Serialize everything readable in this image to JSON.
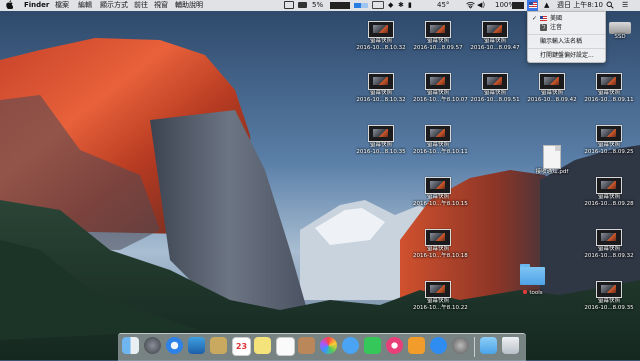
{
  "menubar": {
    "app_name": "Finder",
    "menus": [
      "檔案",
      "編輯",
      "顯示方式",
      "前往",
      "視窗",
      "輔助說明"
    ],
    "battery_small": "5%",
    "temperature": "45°",
    "battery": "100%",
    "clock": "週日 上午8:10",
    "input_icon": "flag-icon",
    "apple_icon": "apple-icon"
  },
  "dropdown": {
    "items": [
      "美國",
      "注音",
      "顯示輸入法名稱",
      "打開鍵盤偏好設定..."
    ],
    "checked": "美國"
  },
  "desktop": {
    "screenshots": [
      {
        "title": "螢幕快照",
        "date": "2016-10...8.10.32"
      },
      {
        "title": "螢幕快照",
        "date": "2016-10...8.09.57"
      },
      {
        "title": "螢幕快照",
        "date": "2016-10...8.09.47"
      },
      {
        "title": "螢幕快照",
        "date": "2016-10...8.10.32"
      },
      {
        "title": "螢幕快照",
        "date": "2016-10...午8.10.07"
      },
      {
        "title": "螢幕快照",
        "date": "2016-10...8.09.51"
      },
      {
        "title": "螢幕快照",
        "date": "2016-10...8.09.42"
      },
      {
        "title": "螢幕快照",
        "date": "2016-10...8.09.11"
      },
      {
        "title": "螢幕快照",
        "date": "2016-10...8.10.35"
      },
      {
        "title": "螢幕快照",
        "date": "2016-10...午8.10.11"
      },
      {
        "title": "螢幕快照",
        "date": "2016-10...8.09.25"
      },
      {
        "title": "螢幕快照",
        "date": "2016-10...午8.10.15"
      },
      {
        "title": "螢幕快照",
        "date": "2016-10...8.09.28"
      },
      {
        "title": "螢幕快照",
        "date": "2016-10...午8.10.18"
      },
      {
        "title": "螢幕快照",
        "date": "2016-10...8.09.32"
      },
      {
        "title": "螢幕快照",
        "date": "2016-10...午8.10.22"
      },
      {
        "title": "螢幕快照",
        "date": "2016-10...8.09.35"
      }
    ],
    "pdf_label": "接收通知.pdf",
    "folder_label": "tools",
    "disk_label": "SSD"
  },
  "dock": {
    "apps": [
      "finder",
      "launchpad",
      "safari",
      "preview",
      "notes-app",
      "calendar",
      "stickies",
      "reminders",
      "contacts",
      "photos",
      "messages",
      "facetime",
      "itunes",
      "ibooks",
      "app-store",
      "system-preferences",
      "downloads-folder",
      "trash"
    ],
    "calendar_day": "23"
  },
  "colors": {
    "menubar_bg": "#eeeef0",
    "accent_blue": "#4fa3e6",
    "dropdown_highlight": "#3b78e7"
  }
}
